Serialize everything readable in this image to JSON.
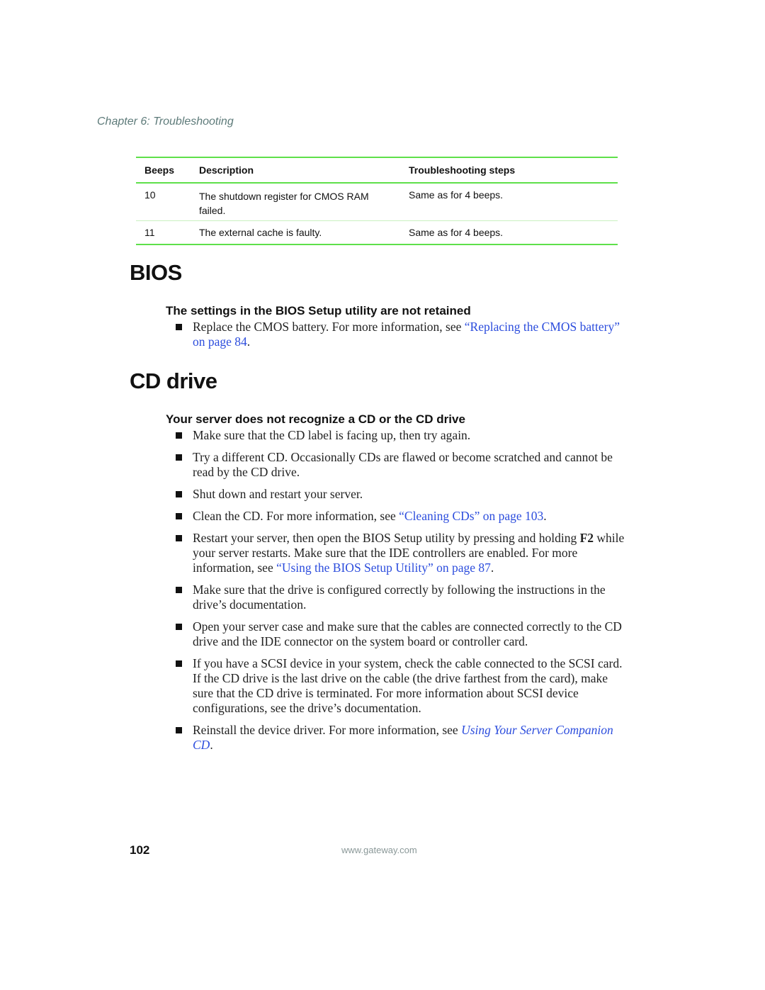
{
  "header": {
    "chapter": "Chapter 6: Troubleshooting"
  },
  "table": {
    "columns": [
      "Beeps",
      "Description",
      "Troubleshooting steps"
    ],
    "rows": [
      {
        "beeps": "10",
        "description": "The shutdown register for CMOS RAM failed.",
        "steps": "Same as for 4 beeps."
      },
      {
        "beeps": "11",
        "description": "The external cache is faulty.",
        "steps": "Same as for 4 beeps."
      }
    ]
  },
  "bios": {
    "title": "BIOS",
    "subtitle": "The settings in the BIOS Setup utility are not retained",
    "items": [
      {
        "text": "Replace the CMOS battery. For more information, see ",
        "link": "“Replacing the CMOS battery” on page 84",
        "after": "."
      }
    ]
  },
  "cd": {
    "title": "CD drive",
    "subtitle": "Your server does not recognize a CD or the CD drive",
    "items": [
      {
        "text": "Make sure that the CD label is facing up, then try again."
      },
      {
        "text": "Try a different CD. Occasionally CDs are flawed or become scratched and cannot be read by the CD drive."
      },
      {
        "text": "Shut down and restart your server."
      },
      {
        "text": "Clean the CD. For more information, see ",
        "link": "“Cleaning CDs” on page 103",
        "after": "."
      },
      {
        "text": "Restart your server, then open the BIOS Setup utility by pressing and holding ",
        "key": "F2",
        "text2": " while your server restarts. Make sure that the IDE controllers are enabled. For more information, see ",
        "link": "“Using the BIOS Setup Utility” on page 87",
        "after": "."
      },
      {
        "text": "Make sure that the drive is configured correctly by following the instructions in the drive’s documentation."
      },
      {
        "text": "Open your server case and make sure that the cables are connected correctly to the CD drive and the IDE connector on the system board or controller card."
      },
      {
        "text": "If you have a SCSI device in your system, check the cable connected to the SCSI card. If the CD drive is the last drive on the cable (the drive farthest from the card), make sure that the CD drive is terminated. For more information about SCSI device configurations, see the drive’s documentation."
      },
      {
        "text": "Reinstall the device driver. For more information, see ",
        "link": "Using Your Server Companion CD",
        "after": "."
      }
    ]
  },
  "footer": {
    "page_number": "102",
    "website": "www.gateway.com"
  }
}
